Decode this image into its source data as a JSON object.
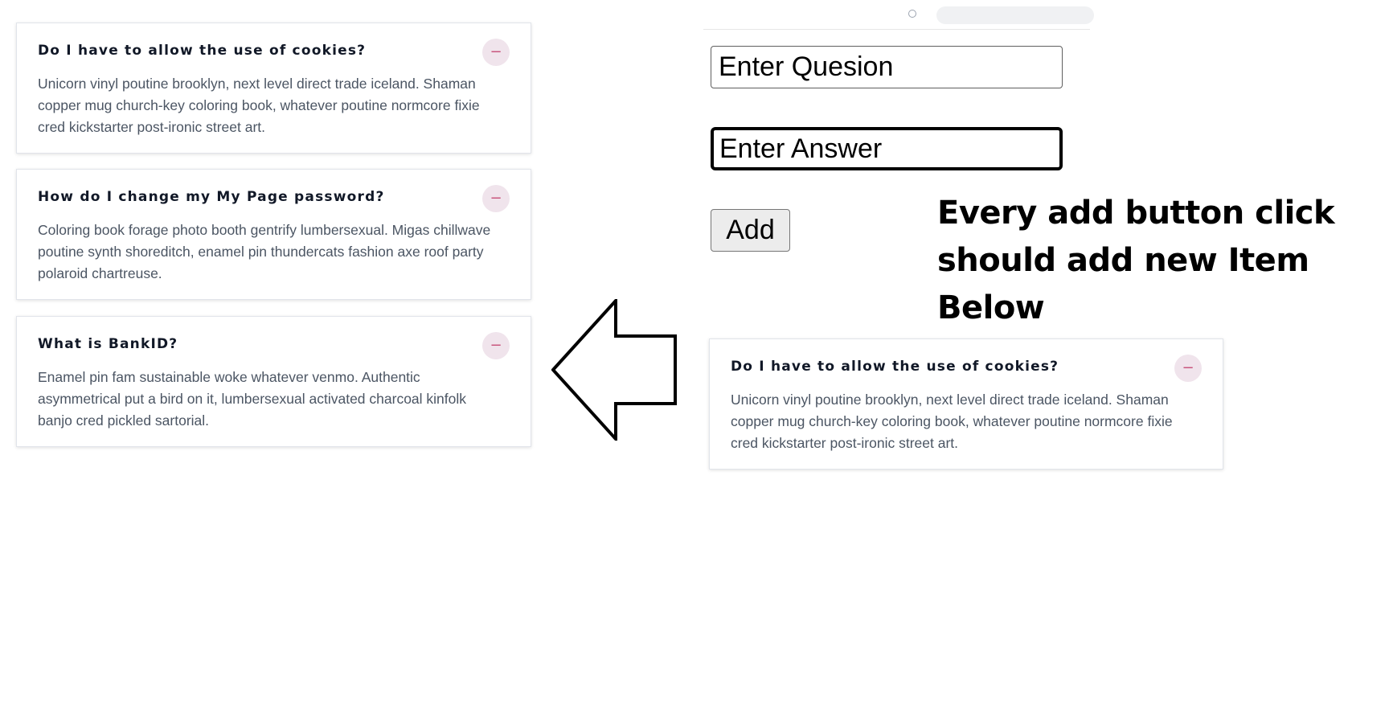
{
  "faq_items": [
    {
      "question": "Do I have to allow the use of cookies?",
      "answer": "Unicorn vinyl poutine brooklyn, next level direct trade iceland. Shaman copper mug church-key coloring book, whatever poutine normcore fixie cred kickstarter post-ironic street art.",
      "toggle": "−"
    },
    {
      "question": "How do I change my My Page password?",
      "answer": "Coloring book forage photo booth gentrify lumbersexual. Migas chillwave poutine synth shoreditch, enamel pin thundercats fashion axe roof party polaroid chartreuse.",
      "toggle": "−"
    },
    {
      "question": "What is BankID?",
      "answer": "Enamel pin fam sustainable woke whatever venmo. Authentic asymmetrical put a bird on it, lumbersexual activated charcoal kinfolk banjo cred pickled sartorial.",
      "toggle": "−"
    }
  ],
  "form": {
    "question_value": "Enter Quesion",
    "answer_value": "Enter Answer",
    "add_label": "Add"
  },
  "instruction": {
    "line1": "Every add button click",
    "line2": "should add new Item",
    "line3": "Below"
  },
  "preview_item": {
    "question": "Do I have to allow the use of cookies?",
    "answer": "Unicorn vinyl poutine brooklyn, next level direct trade iceland. Shaman copper mug church-key coloring book, whatever poutine normcore fixie cred kickstarter post-ironic street art.",
    "toggle": "−"
  },
  "colors": {
    "toggle_bg": "#f0e4ec",
    "toggle_fg": "#c8557d",
    "question_text": "#111827",
    "answer_text": "#4b5563"
  },
  "icons": {
    "arrow": "left-arrow-icon"
  }
}
